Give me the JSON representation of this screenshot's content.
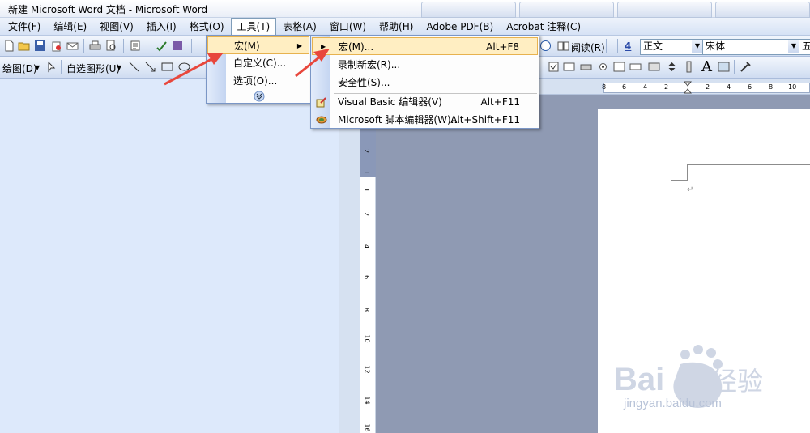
{
  "window": {
    "title": "新建 Microsoft Word 文档 - Microsoft Word"
  },
  "menubar": {
    "items": [
      {
        "label": "文件(F)"
      },
      {
        "label": "编辑(E)"
      },
      {
        "label": "视图(V)"
      },
      {
        "label": "插入(I)"
      },
      {
        "label": "格式(O)"
      },
      {
        "label": "工具(T)"
      },
      {
        "label": "表格(A)"
      },
      {
        "label": "窗口(W)"
      },
      {
        "label": "帮助(H)"
      },
      {
        "label": "Adobe PDF(B)"
      },
      {
        "label": "Acrobat 注释(C)"
      }
    ]
  },
  "toolbar1": {
    "read_label": "阅读(R)",
    "style_value": "正文",
    "font_value": "宋体",
    "size_value": "五号",
    "style_icon_text": "4"
  },
  "toolbar2": {
    "draw_label": "绘图(D)",
    "autoshape_label": "自选图形(U)",
    "font_a": "A"
  },
  "tools_menu": {
    "items": [
      {
        "label": "宏(M)"
      },
      {
        "label": "自定义(C)..."
      },
      {
        "label": "选项(O)..."
      }
    ]
  },
  "macro_menu": {
    "items": [
      {
        "label": "宏(M)...",
        "shortcut": "Alt+F8"
      },
      {
        "label": "录制新宏(R)...",
        "shortcut": ""
      },
      {
        "label": "安全性(S)...",
        "shortcut": ""
      },
      {
        "label": "Visual Basic 编辑器(V)",
        "shortcut": "Alt+F11"
      },
      {
        "label": "Microsoft 脚本编辑器(W)...",
        "shortcut": "Alt+Shift+F11"
      }
    ]
  },
  "hruler": {
    "ticks": [
      "8",
      "6",
      "4",
      "2",
      "2",
      "4",
      "6",
      "8",
      "10"
    ]
  },
  "vruler": {
    "ticks": [
      "2",
      "1",
      "1",
      "2",
      "4",
      "6",
      "8",
      "10",
      "12",
      "14",
      "16"
    ]
  },
  "watermark": {
    "url": "jingyan.baidu.com"
  },
  "colors": {
    "highlight": "#ffeec2",
    "arrow": "#e8473c",
    "menu_border": "#7a96c6"
  }
}
